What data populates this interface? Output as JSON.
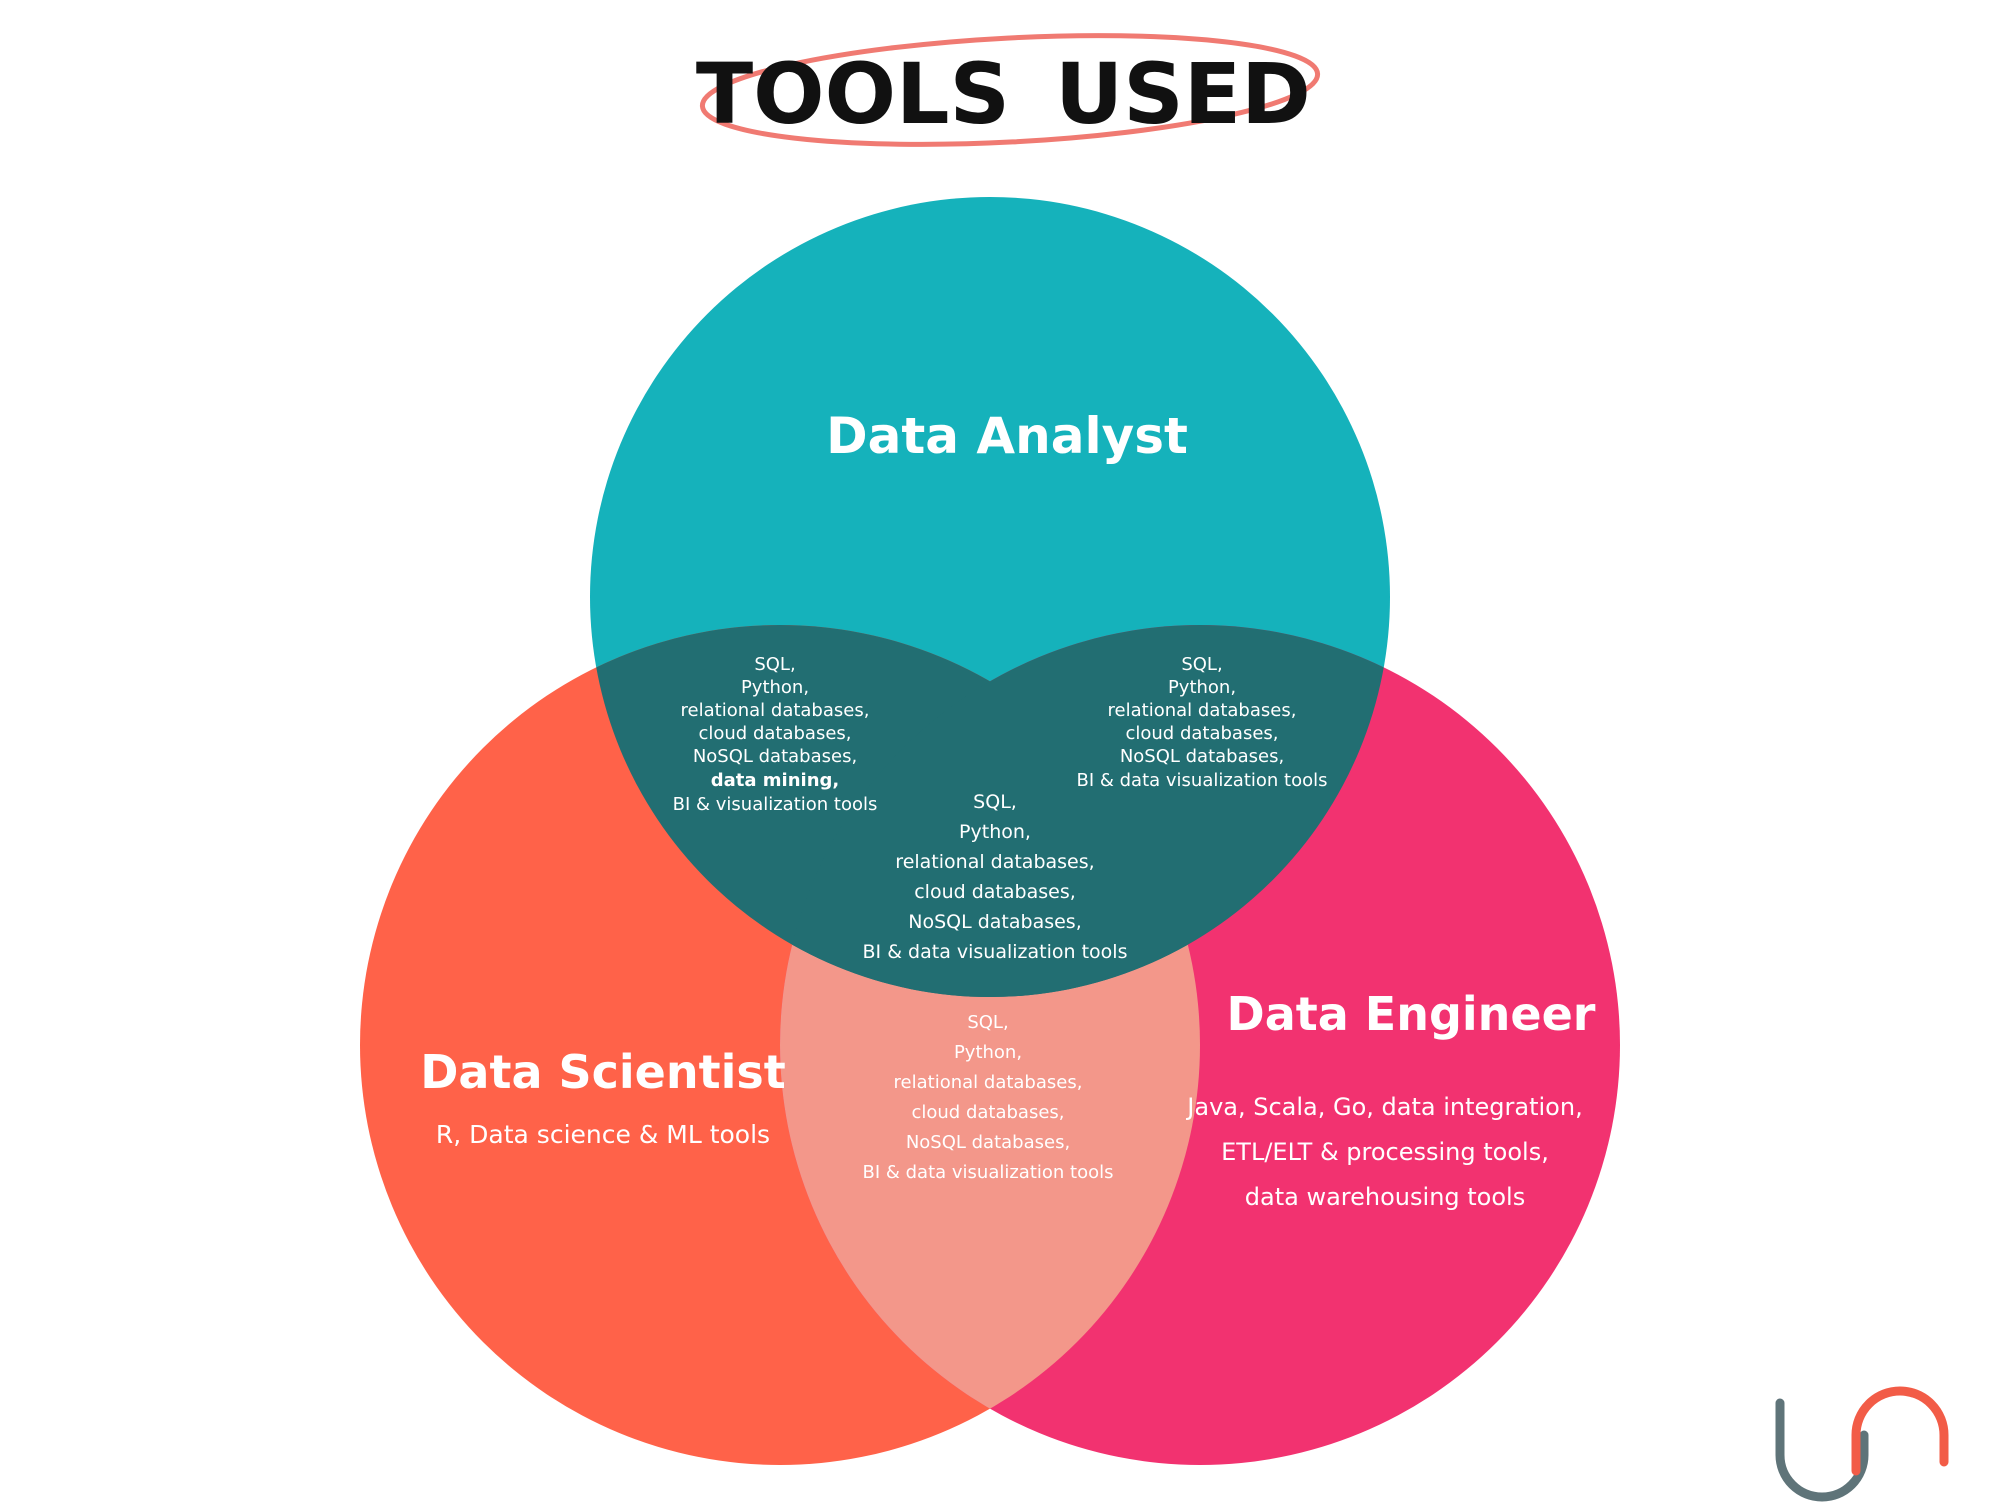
{
  "title": {
    "word1": "TOOLS",
    "word2": "USED"
  },
  "colors": {
    "analyst": "#15b2bb",
    "scientist": "#ff6249",
    "engineer": "#f23270",
    "overlap_dark": "#226e72",
    "overlap_light": "#f3978a",
    "title_ellipse": "#f07a72",
    "logo_gray": "#5f7479",
    "logo_orange": "#f25c47"
  },
  "circles": {
    "analyst": {
      "heading": "Data Analyst"
    },
    "scientist": {
      "heading": "Data Scientist",
      "tools": [
        "R, Data science & ML tools"
      ]
    },
    "engineer": {
      "heading": "Data Engineer",
      "tools": [
        "Java, Scala, Go, data integration,",
        "ETL/ELT & processing tools,",
        "data warehousing tools"
      ]
    }
  },
  "overlaps": {
    "analyst_scientist": [
      "SQL,",
      "Python,",
      "relational databases,",
      "cloud databases,",
      "NoSQL databases,",
      "data mining,",
      "BI & visualization tools"
    ],
    "analyst_engineer": [
      "SQL,",
      "Python,",
      "relational databases,",
      "cloud databases,",
      "NoSQL databases,",
      "BI & data visualization tools"
    ],
    "all_three": [
      "SQL,",
      "Python,",
      "relational databases,",
      "cloud databases,",
      "NoSQL databases,",
      "BI & data visualization tools"
    ],
    "scientist_engineer": [
      "SQL,",
      "Python,",
      "relational databases,",
      "cloud databases,",
      "NoSQL databases,",
      "BI & data visualization tools"
    ]
  },
  "logo": {
    "icon": "brand-logo-icon"
  }
}
